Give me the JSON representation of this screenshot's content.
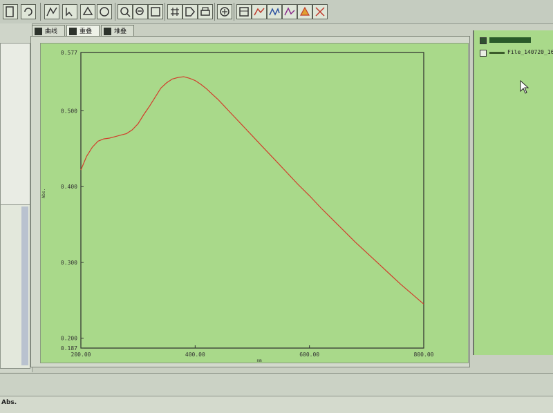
{
  "tabs": [
    {
      "label": "曲线"
    },
    {
      "label": "重叠"
    },
    {
      "label": "堆叠"
    }
  ],
  "legend": {
    "items": [
      {
        "checked": true,
        "label": "",
        "color": "#2a5a2a"
      },
      {
        "checked": false,
        "label": "File_140720_16",
        "color": "#3b5b2b"
      }
    ]
  },
  "status": {
    "text": "Abs."
  },
  "chart_data": {
    "type": "line",
    "xlabel": "nm",
    "ylabel": "Abs.",
    "xlim": [
      200.0,
      800.0
    ],
    "ylim": [
      0.187,
      0.577
    ],
    "x_tick_labels": [
      "200.00",
      "400.00",
      "600.00",
      "800.00"
    ],
    "x_ticks": [
      200,
      400,
      600,
      800
    ],
    "y_tick_labels": [
      "0.187",
      "0.200",
      "0.300",
      "0.400",
      "0.500",
      "0.577"
    ],
    "y_ticks": [
      0.187,
      0.2,
      0.3,
      0.4,
      0.5,
      0.577
    ],
    "series": [
      {
        "color": "#d23c2c",
        "x": [
          200,
          210,
          220,
          230,
          240,
          250,
          260,
          270,
          280,
          290,
          300,
          310,
          320,
          330,
          340,
          350,
          360,
          370,
          380,
          390,
          400,
          410,
          420,
          430,
          440,
          450,
          460,
          470,
          480,
          490,
          500,
          520,
          540,
          560,
          580,
          600,
          620,
          640,
          660,
          680,
          700,
          720,
          740,
          760,
          780,
          800
        ],
        "y": [
          0.422,
          0.44,
          0.452,
          0.46,
          0.463,
          0.464,
          0.466,
          0.468,
          0.47,
          0.475,
          0.483,
          0.495,
          0.506,
          0.518,
          0.53,
          0.537,
          0.542,
          0.544,
          0.545,
          0.543,
          0.54,
          0.535,
          0.529,
          0.522,
          0.515,
          0.507,
          0.499,
          0.491,
          0.483,
          0.475,
          0.467,
          0.451,
          0.435,
          0.419,
          0.403,
          0.388,
          0.372,
          0.357,
          0.342,
          0.327,
          0.313,
          0.299,
          0.285,
          0.271,
          0.258,
          0.245
        ]
      }
    ],
    "grid": false
  }
}
